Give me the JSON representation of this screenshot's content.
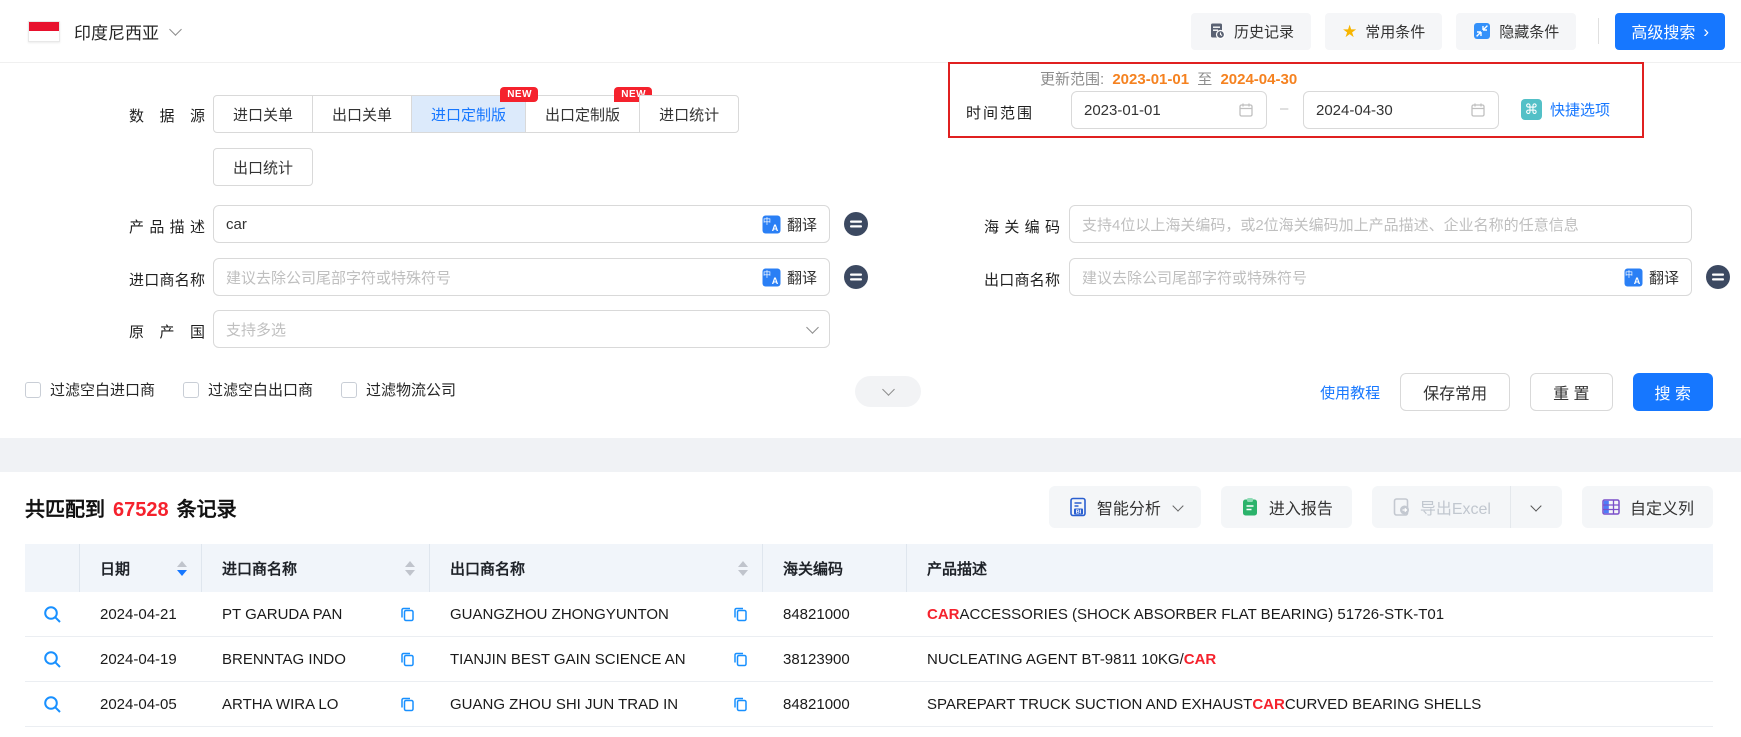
{
  "colors": {
    "accent": "#1677ff",
    "badge_red": "#f5222d",
    "highlight_red": "#f5222d",
    "range_orange": "#f58220",
    "box_border_red": "#e02020"
  },
  "topbar": {
    "country": "印度尼西亚",
    "history_label": "历史记录",
    "favorites_label": "常用条件",
    "hide_label": "隐藏条件",
    "advanced_label": "高级搜索",
    "advanced_arrow": "›"
  },
  "icons": {
    "quick_glyph": "⌘",
    "star_glyph": "★",
    "translate_glyph_top": "中",
    "translate_glyph_bottom": "A"
  },
  "form": {
    "datasource_label": "数据源",
    "tabs": [
      {
        "label": "进口关单",
        "active": false,
        "badge": ""
      },
      {
        "label": "出口关单",
        "active": false,
        "badge": ""
      },
      {
        "label": "进口定制版",
        "active": true,
        "badge": "NEW"
      },
      {
        "label": "出口定制版",
        "active": false,
        "badge": "NEW"
      },
      {
        "label": "进口统计",
        "active": false,
        "badge": ""
      },
      {
        "label": "出口统计",
        "active": false,
        "badge": ""
      }
    ],
    "update_range": {
      "label": "更新范围:",
      "from": "2023-01-01",
      "separator": "至",
      "to": "2024-04-30"
    },
    "time_range": {
      "label": "时间范围",
      "from": "2023-01-01",
      "to": "2024-04-30",
      "quick_label": "快捷选项"
    },
    "product_desc": {
      "label": "产品描述",
      "value": "car",
      "translate_label": "翻译"
    },
    "hs_code": {
      "label": "海关编码",
      "placeholder": "支持4位以上海关编码，或2位海关编码加上产品描述、企业名称的任意信息"
    },
    "importer": {
      "label": "进口商名称",
      "placeholder": "建议去除公司尾部字符或特殊符号",
      "translate_label": "翻译"
    },
    "exporter": {
      "label": "出口商名称",
      "placeholder": "建议去除公司尾部字符或特殊符号",
      "translate_label": "翻译"
    },
    "origin": {
      "label": "原产国",
      "placeholder": "支持多选"
    },
    "checkboxes": [
      {
        "label": "过滤空白进口商",
        "checked": false
      },
      {
        "label": "过滤空白出口商",
        "checked": false
      },
      {
        "label": "过滤物流公司",
        "checked": false
      }
    ],
    "tutorial_link": "使用教程",
    "save_button": "保存常用",
    "reset_button": "重 置",
    "search_button": "搜 索"
  },
  "results": {
    "count_prefix": "共匹配到",
    "count": "67528",
    "count_suffix": "条记录",
    "actions": {
      "analyze": "智能分析",
      "report": "进入报告",
      "export": "导出Excel",
      "columns": "自定义列"
    },
    "table": {
      "headers": [
        {
          "label": "",
          "sortable": false
        },
        {
          "label": "日期",
          "sortable": true,
          "sort": "desc"
        },
        {
          "label": "进口商名称",
          "sortable": true,
          "sort": ""
        },
        {
          "label": "出口商名称",
          "sortable": true,
          "sort": ""
        },
        {
          "label": "海关编码",
          "sortable": false
        },
        {
          "label": "产品描述",
          "sortable": false
        }
      ],
      "rows": [
        {
          "date": "2024-04-21",
          "importer": "PT GARUDA PAN",
          "exporter": "GUANGZHOU ZHONGYUNTON",
          "hs_code": "84821000",
          "desc": [
            {
              "t": "CAR",
              "hl": true
            },
            {
              "t": " ACCESSORIES (SHOCK ABSORBER FLAT BEARING) 51726-STK-T01",
              "hl": false
            }
          ]
        },
        {
          "date": "2024-04-19",
          "importer": "BRENNTAG INDO",
          "exporter": "TIANJIN BEST GAIN SCIENCE AN",
          "hs_code": "38123900",
          "desc": [
            {
              "t": "NUCLEATING AGENT BT-9811 10KG/",
              "hl": false
            },
            {
              "t": "CAR",
              "hl": true
            }
          ]
        },
        {
          "date": "2024-04-05",
          "importer": "ARTHA WIRA LO",
          "exporter": "GUANG ZHOU SHI JUN TRAD IN",
          "hs_code": "84821000",
          "desc": [
            {
              "t": "SPAREPART TRUCK SUCTION AND EXHAUST ",
              "hl": false
            },
            {
              "t": "CAR",
              "hl": true
            },
            {
              "t": " CURVED BEARING SHELLS",
              "hl": false
            }
          ]
        }
      ]
    }
  }
}
